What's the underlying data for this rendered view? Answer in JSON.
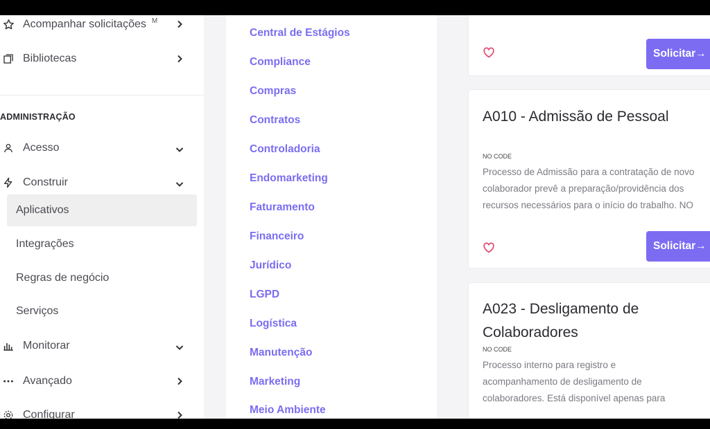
{
  "sidebar": {
    "top_items": [
      {
        "label": "Acompanhar solicitações",
        "badge": "M",
        "icon": "star-icon"
      },
      {
        "label": "Bibliotecas",
        "icon": "library-icon"
      }
    ],
    "section_title": "ADMINISTRAÇÃO",
    "admin_items": [
      {
        "label": "Acesso",
        "icon": "user-icon"
      },
      {
        "label": "Construir",
        "icon": "bolt-icon"
      }
    ],
    "construir_sub": [
      {
        "label": "Aplicativos"
      },
      {
        "label": "Integrações"
      },
      {
        "label": "Regras de negócio"
      },
      {
        "label": "Serviços"
      }
    ],
    "bottom_items": [
      {
        "label": "Monitorar",
        "icon": "bar-chart-icon"
      },
      {
        "label": "Avançado",
        "icon": "more-dots-icon"
      },
      {
        "label": "Configurar",
        "icon": "settings-icon"
      }
    ]
  },
  "categories": [
    "Central de Estágios",
    "Compliance",
    "Compras",
    "Contratos",
    "Controladoria",
    "Endomarketing",
    "Faturamento",
    "Financeiro",
    "Jurídico",
    "LGPD",
    "Logística",
    "Manutenção",
    "Marketing",
    "Meio Ambiente"
  ],
  "cards": {
    "top": {
      "button": "Solicitar→"
    },
    "admissao": {
      "title": "A010 - Admissão de Pessoal",
      "tag": "NO CODE",
      "description": "Processo de Admissão para a contratação de novo\ncolaborador prevê a preparação/providência dos\nrecursos necessários para o início do trabalho. NO",
      "button": "Solicitar→"
    },
    "desligamento": {
      "title": "A023 - Desligamento de Colaboradores",
      "tag": "NO CODE",
      "description": "Processo interno para registro e\nacompanhamento de desligamento de\ncolaboradores. Está disponível apenas para"
    }
  },
  "colors": {
    "accent": "#7c6cf2",
    "link": "#7b6df0",
    "heart": "#e0446a"
  }
}
